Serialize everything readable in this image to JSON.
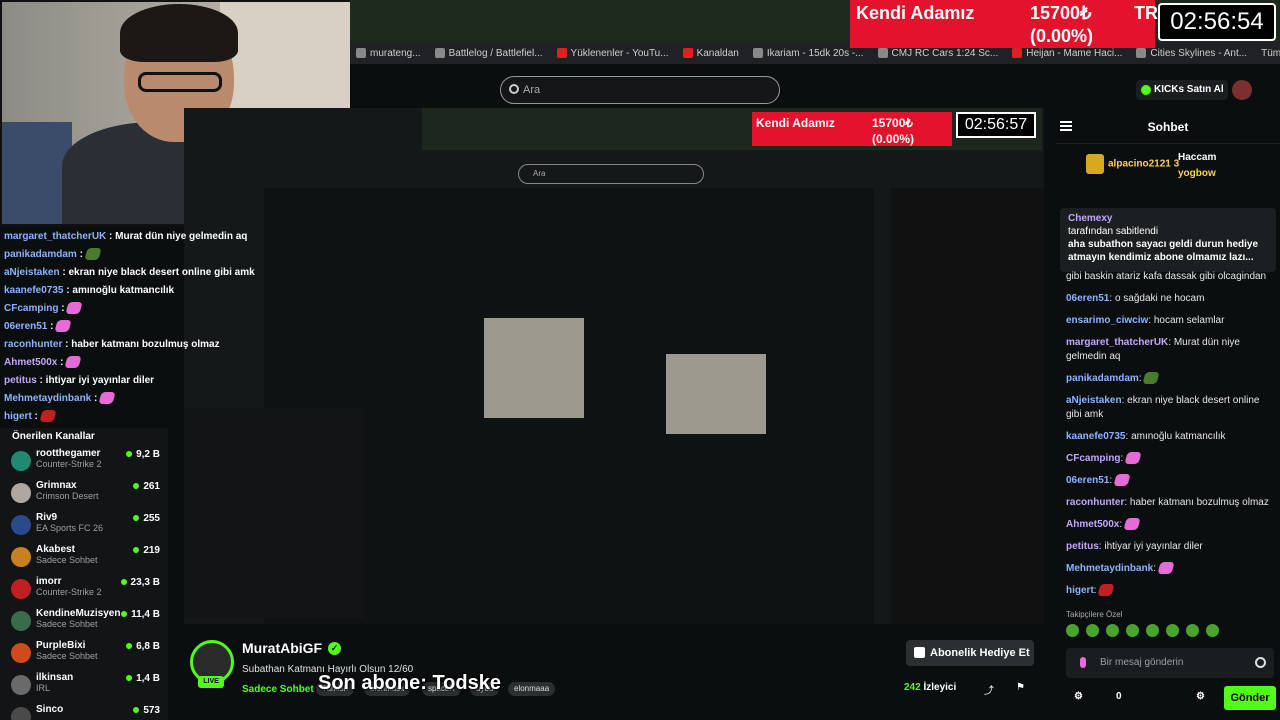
{
  "browser": {
    "bookmarks": [
      "murateng...",
      "Battlelog / Battlefiel...",
      "Yüklenenler - YouTu...",
      "Kanaldan",
      "Ikariam - 15dk 20s -...",
      "CMJ RC Cars 1:24 Sc...",
      "Heijan - Mame Haci...",
      "Cities Skylines - Ant..."
    ],
    "bookmarks_right": "Tüm Yer İşaretleri"
  },
  "overlay": {
    "name": "Kendi Adamız",
    "price": "15700₺",
    "change": "(0.00%)",
    "ticker": "TR",
    "timer": "02:56:54"
  },
  "header": {
    "search_placeholder": "Ara",
    "kicks_label": "KICKs Satın Al"
  },
  "left_chat": [
    {
      "user": "margaret_thatcherUK",
      "text": "Murat dün niye gelmedin aq"
    },
    {
      "user": "panikadamdam",
      "text": ""
    },
    {
      "user": "aNjeistaken",
      "text": "ekran niye black desert online gibi amk"
    },
    {
      "user": "kaanefe0735",
      "text": "amınoğlu katmancılık"
    },
    {
      "user": "CFcamping",
      "text": ""
    },
    {
      "user": "06eren51",
      "text": ""
    },
    {
      "user": "raconhunter",
      "text": "haber katmanı bozulmuş olmaz"
    },
    {
      "user": "Ahmet500x",
      "text": ""
    },
    {
      "user": "petitus",
      "text": "ihtiyar iyi yayınlar diler"
    },
    {
      "user": "Mehmetaydinbank",
      "text": ""
    },
    {
      "user": "higert",
      "text": ""
    }
  ],
  "sidebar": {
    "title": "Önerilen Kanallar",
    "channels": [
      {
        "name": "rootthegamer",
        "game": "Counter-Strike 2",
        "viewers": "9,2 B",
        "color": "#1f8a70"
      },
      {
        "name": "Grimnax",
        "game": "Crimson Desert",
        "viewers": "261",
        "color": "#b0a8a0"
      },
      {
        "name": "Riv9",
        "game": "EA Sports FC 26",
        "viewers": "255",
        "color": "#2a4a8a"
      },
      {
        "name": "Akabest",
        "game": "Sadece Sohbet",
        "viewers": "219",
        "color": "#c9801e"
      },
      {
        "name": "imorr",
        "game": "Counter-Strike 2",
        "viewers": "23,3 B",
        "color": "#c02020"
      },
      {
        "name": "KendineMuzisyen",
        "game": "Sadece Sohbet",
        "viewers": "11,4 B",
        "color": "#3a6b4a"
      },
      {
        "name": "PurpleBixi",
        "game": "Sadece Sohbet",
        "viewers": "6,8 B",
        "color": "#d04a1a"
      },
      {
        "name": "ilkinsan",
        "game": "IRL",
        "viewers": "1,4 B",
        "color": "#6a6a6a"
      },
      {
        "name": "Sinco",
        "game": "",
        "viewers": "573",
        "color": "#4a4a4a"
      }
    ]
  },
  "stream": {
    "streamer": "MuratAbiGF",
    "live": "LIVE",
    "title": "Subathan Katmanı Hayırlı Olsun 12/60",
    "category": "Sadece Sohbet",
    "tags": [
      "Turkish",
      "elonmusk",
      "spaceX",
      "uydu",
      "elonmaaa"
    ],
    "subtitle": "Son abone: Todske",
    "gift_sub": "Abonelik Hediye Et",
    "viewers": "242",
    "viewers_label": "İzleyici"
  },
  "chat": {
    "title": "Sohbet",
    "gifters": [
      {
        "name": "alpacino2121",
        "count": "3"
      },
      {
        "name": "Haccam"
      },
      {
        "name": "yogbow"
      }
    ],
    "pinned": {
      "user": "Chemexy",
      "by": "tarafından sabitlendi",
      "text": "aha subathon sayacı geldi durun hediye atmayın kendimiz abone olmamız lazı..."
    },
    "messages": [
      {
        "user": "",
        "text": "gibi baskin atariz kafa dassak gibi olcagindan"
      },
      {
        "user": "06eren51",
        "text": "o sağdaki ne hocam"
      },
      {
        "user": "ensarimo_ciwciw",
        "text": "hocam selamlar"
      },
      {
        "user": "margaret_thatcherUK",
        "text": "Murat dün niye gelmedin aq"
      },
      {
        "user": "panikadamdam",
        "text": ""
      },
      {
        "user": "aNjeistaken",
        "text": "ekran niye black desert online gibi amk"
      },
      {
        "user": "kaanefe0735",
        "text": "amınoğlu katmancılık"
      },
      {
        "user": "CFcamping",
        "text": ""
      },
      {
        "user": "06eren51",
        "text": ""
      },
      {
        "user": "raconhunter",
        "text": "haber katmanı bozulmuş olmaz"
      },
      {
        "user": "Ahmet500x",
        "text": ""
      },
      {
        "user": "petitus",
        "text": "ihtiyar iyi yayınlar diler"
      },
      {
        "user": "Mehmetaydinbank",
        "text": ""
      },
      {
        "user": "higert",
        "text": ""
      }
    ],
    "favorites_label": "Takipçilere Özel",
    "input_placeholder": "Bir mesaj gönderin",
    "points": "0",
    "send_label": "Gönder"
  }
}
